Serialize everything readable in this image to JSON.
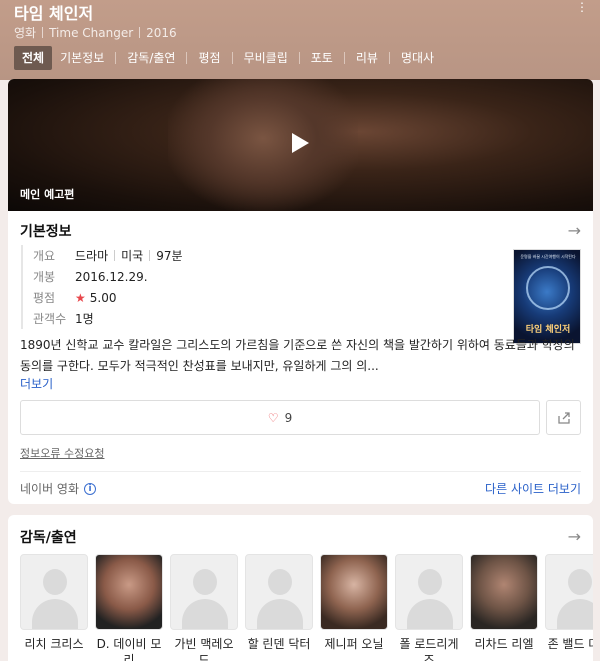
{
  "header": {
    "title": "타임 체인저",
    "meta": [
      "영화",
      "Time Changer",
      "2016"
    ],
    "tabs": [
      "전체",
      "기본정보",
      "감독/출연",
      "평점",
      "무비클립",
      "포토",
      "리뷰",
      "명대사"
    ]
  },
  "video": {
    "label": "메인 예고편"
  },
  "basic_info": {
    "title": "기본정보",
    "rows": {
      "overview": {
        "key": "개요",
        "genre": "드라마",
        "country": "미국",
        "runtime": "97분"
      },
      "release": {
        "key": "개봉",
        "value": "2016.12.29."
      },
      "rating": {
        "key": "평점",
        "value": "5.00"
      },
      "audience": {
        "key": "관객수",
        "value": "1명"
      }
    },
    "poster_title": "타임 체인저",
    "poster_tagline": "운명을 바꿀 시간여행이 시작된다",
    "synopsis": "1890년 신학교 교수 칼라일은 그리스도의 가르침을 기준으로 쓴 자신의 책을 발간하기 위하여 동료들과 학장의 동의를 구한다. 모두가 적극적인 찬성표를 보내지만, 유일하게 그의 의...",
    "more_label": "더보기",
    "like_count": "9",
    "report_label": "정보오류 수정요청",
    "source_label": "네이버 영화",
    "other_sites_label": "다른 사이트 더보기"
  },
  "cast_section": {
    "title": "감독/출연",
    "people": [
      {
        "name": "리치 크리스"
      },
      {
        "name": "D. 데이비 모리"
      },
      {
        "name": "가빈 맥레오드"
      },
      {
        "name": "할 린덴 닥터"
      },
      {
        "name": "제니퍼 오닐"
      },
      {
        "name": "폴 로드리게즈"
      },
      {
        "name": "리차드 리엘"
      },
      {
        "name": "존 밸드 대로"
      }
    ]
  },
  "colors": {
    "header_bg": "#c29d8a",
    "active_tab": "#6e5a50",
    "link": "#2a61c9",
    "accent_red": "#e8474b"
  }
}
